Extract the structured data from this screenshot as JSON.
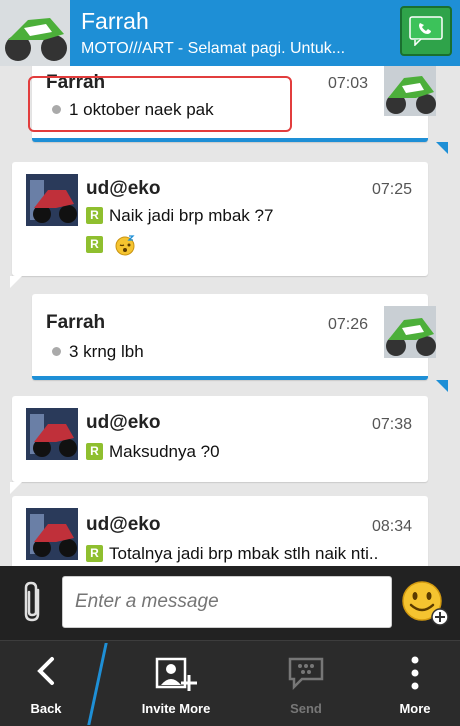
{
  "header": {
    "title": "Farrah",
    "subtitle": "MOTO///ART - Selamat pagi.  Untuk..."
  },
  "messages": [
    {
      "name": "Farrah",
      "time": "07:03",
      "text": "1 oktober naek pak",
      "direction": "outgoing"
    },
    {
      "name": "ud@eko",
      "time": "07:25",
      "text": "Naik jadi brp mbak ?7",
      "direction": "incoming",
      "second_line": "emoji"
    },
    {
      "name": "Farrah",
      "time": "07:26",
      "text": "3 krng lbh",
      "direction": "outgoing"
    },
    {
      "name": "ud@eko",
      "time": "07:38",
      "text": "Maksudnya ?0",
      "direction": "incoming"
    },
    {
      "name": "ud@eko",
      "time": "08:34",
      "text": "Totalnya jadi brp mbak stlh naik nti..",
      "direction": "incoming"
    }
  ],
  "badge": {
    "read_letter": "R"
  },
  "composer": {
    "placeholder": "Enter a message"
  },
  "actions": {
    "back": "Back",
    "invite_more": "Invite More",
    "send": "Send",
    "more": "More"
  },
  "colors": {
    "accent": "#1e8fd6",
    "call_green": "#2fa34a",
    "read_badge": "#8fbf2f",
    "highlight_red": "#e23d3d"
  }
}
